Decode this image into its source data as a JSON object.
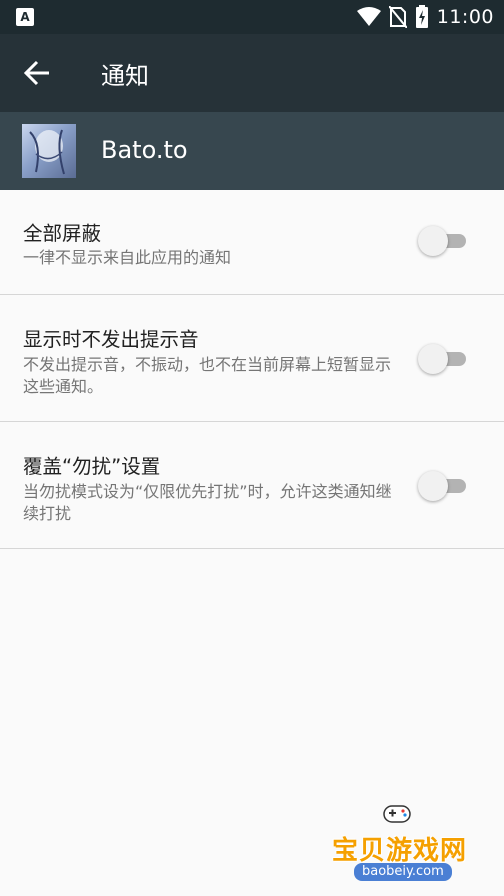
{
  "status_bar": {
    "time": "11:00",
    "icons": [
      "a-notification-icon",
      "wifi-icon",
      "no-sim-icon",
      "battery-charging-icon"
    ]
  },
  "app_bar": {
    "title": "通知",
    "back_icon": "arrow-back-icon"
  },
  "app_header": {
    "name": "Bato.to"
  },
  "settings": [
    {
      "title": "全部屏蔽",
      "subtitle": "一律不显示来自此应用的通知",
      "enabled": false
    },
    {
      "title": "显示时不发出提示音",
      "subtitle": "不发出提示音，不振动，也不在当前屏幕上短暂显示这些通知。",
      "enabled": false
    },
    {
      "title": "覆盖“勿扰”设置",
      "subtitle": "当勿扰模式设为“仅限优先打扰”时，允许这类通知继续打扰",
      "enabled": false
    }
  ],
  "watermark": {
    "text": "宝贝游戏网",
    "url": "baobeiy.com"
  },
  "colors": {
    "status_bar": "#1e2b30",
    "app_bar": "#263238",
    "app_header": "#37474f",
    "background": "#fafafa"
  }
}
